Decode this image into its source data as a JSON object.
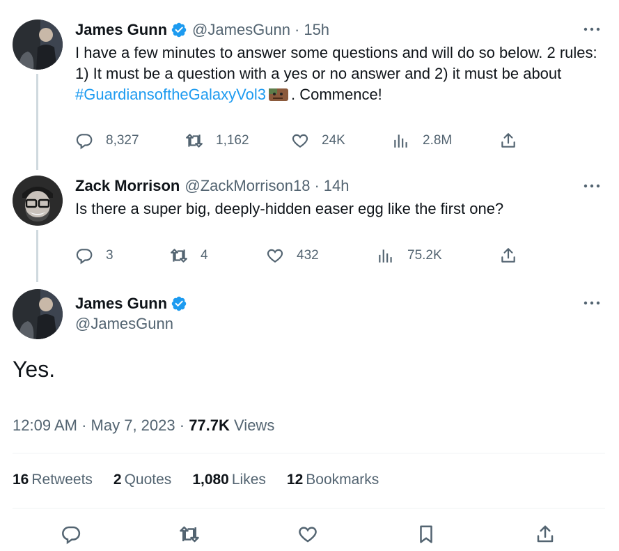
{
  "tweet1": {
    "name": "James Gunn",
    "handle": "@JamesGunn",
    "sep": "·",
    "time": "15h",
    "text_before": "I have a few minutes to answer some questions and will do so below. 2 rules: 1) It must be a question with a yes or no answer and 2) it must be about ",
    "hashtag": "#GuardiansoftheGalaxyVol3",
    "text_after": ". Commence!",
    "replies": "8,327",
    "retweets": "1,162",
    "likes": "24K",
    "views": "2.8M"
  },
  "tweet2": {
    "name": "Zack Morrison",
    "handle": "@ZackMorrison18",
    "sep": "·",
    "time": "14h",
    "text": "Is there a super big, deeply-hidden easer egg like the first one?",
    "replies": "3",
    "retweets": "4",
    "likes": "432",
    "views": "75.2K"
  },
  "tweet3": {
    "name": "James Gunn",
    "handle": "@JamesGunn",
    "text": "Yes.",
    "time": "12:09 AM",
    "sep1": "·",
    "date": "May 7, 2023",
    "sep2": "·",
    "views_count": "77.7K",
    "views_label": "Views",
    "stats": {
      "retweets_count": "16",
      "retweets_label": "Retweets",
      "quotes_count": "2",
      "quotes_label": "Quotes",
      "likes_count": "1,080",
      "likes_label": "Likes",
      "bookmarks_count": "12",
      "bookmarks_label": "Bookmarks"
    }
  },
  "colors": {
    "accent": "#1d9bf0",
    "text": "#0f1419",
    "secondary": "#536471",
    "thread_line": "#cfd9de"
  },
  "icons": [
    "verified-badge-icon",
    "more-icon",
    "reply-icon",
    "retweet-icon",
    "like-icon",
    "views-icon",
    "share-icon",
    "bookmark-icon",
    "groot-emoji-icon"
  ]
}
